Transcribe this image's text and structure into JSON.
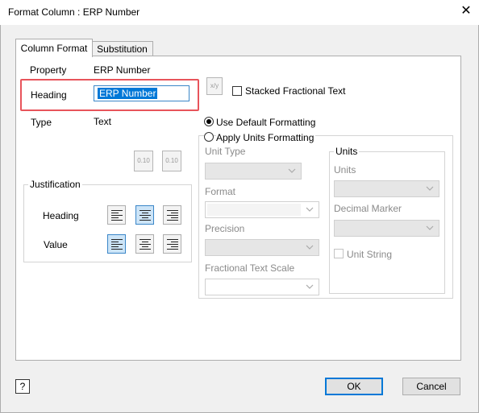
{
  "window": {
    "title": "Format Column : ERP Number",
    "close_glyph": "✕"
  },
  "tabs": [
    {
      "label": "Column Format",
      "active": true
    },
    {
      "label": "Substitution",
      "active": false
    }
  ],
  "column_format": {
    "property_label": "Property",
    "property_value": "ERP Number",
    "heading_label": "Heading",
    "heading_value": "ERP Number",
    "type_label": "Type",
    "type_value": "Text",
    "stacked_fractional_text_label": "Stacked Fractional Text",
    "stacked_fractional_text_checked": false,
    "decimal_buttons": [
      "0.10",
      "0.10"
    ],
    "stack_button_glyph": "x/y"
  },
  "justification": {
    "group_label": "Justification",
    "heading_label": "Heading",
    "value_label": "Value",
    "heading_selected": "center",
    "value_selected": "left"
  },
  "formatting": {
    "use_default_label": "Use Default Formatting",
    "apply_units_label": "Apply Units Formatting",
    "selected": "use_default",
    "unit_type_label": "Unit Type",
    "format_label": "Format",
    "precision_label": "Precision",
    "fractional_text_scale_label": "Fractional Text Scale",
    "units_group_label": "Units",
    "units_label": "Units",
    "decimal_marker_label": "Decimal Marker",
    "unit_string_label": "Unit String"
  },
  "footer": {
    "help_glyph": "?",
    "ok_label": "OK",
    "cancel_label": "Cancel"
  },
  "colors": {
    "accent": "#0078d7",
    "highlight": "#e8545b"
  }
}
